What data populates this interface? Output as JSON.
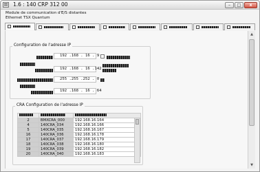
{
  "window": {
    "title": "1.6 : 140 CRP 312 00",
    "min_glyph": "–",
    "max_glyph": "□",
    "close_glyph": "x"
  },
  "module": {
    "description": "Module de communication d'E/S distantes",
    "network": "Ethernet TSX Quantum"
  },
  "ip_config": {
    "title": "Configuration de l'adresse IP",
    "fields": [
      "192 .168 . 16 . 9",
      "192 .168 . 16 .142",
      "255 .255 .252 . 0",
      "192 .168 . 16 . 64"
    ]
  },
  "cra_config": {
    "title": "CRA Configuration de l'adresse IP",
    "rows": [
      {
        "idx": "2",
        "name": "BMXCRA_000",
        "ip": "192.168.16.164"
      },
      {
        "idx": "4",
        "name": "140CRA_034",
        "ip": "192.168.16.166"
      },
      {
        "idx": "5",
        "name": "140CRA_035",
        "ip": "192.168.16.167"
      },
      {
        "idx": "16",
        "name": "140CRA_036",
        "ip": "192.168.16.178"
      },
      {
        "idx": "17",
        "name": "140CRA_037",
        "ip": "192.168.16.179"
      },
      {
        "idx": "18",
        "name": "140CRA_038",
        "ip": "192.168.16.180"
      },
      {
        "idx": "19",
        "name": "140CRA_039",
        "ip": "192.168.16.182"
      },
      {
        "idx": "20",
        "name": "140CRA_040",
        "ip": "192.168.16.183"
      }
    ]
  },
  "scroll": {
    "up": "▲",
    "down": "▼"
  }
}
